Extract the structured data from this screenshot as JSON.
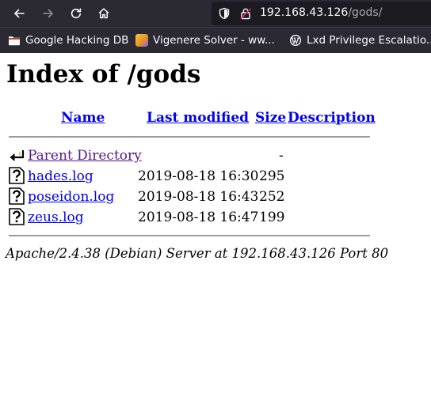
{
  "browser": {
    "url_host": "192.168.43.126",
    "url_path": "/gods/",
    "bookmarks": [
      {
        "label": "Google Hacking DB",
        "icon": "folder-icon"
      },
      {
        "label": "Vigenere Solver - ww...",
        "icon": "site-favicon"
      },
      {
        "label": "Lxd Privilege Escalatio...",
        "icon": "wordpress-icon"
      }
    ]
  },
  "page": {
    "title": "Index of /gods",
    "columns": {
      "name": "Name",
      "modified": "Last modified",
      "size": "Size",
      "description": "Description"
    },
    "parent": {
      "name": "Parent Directory",
      "size": "-"
    },
    "files": [
      {
        "name": "hades.log",
        "modified": "2019-08-18 16:30",
        "size": "295"
      },
      {
        "name": "poseidon.log",
        "modified": "2019-08-18 16:43",
        "size": "252"
      },
      {
        "name": "zeus.log",
        "modified": "2019-08-18 16:47",
        "size": "199"
      }
    ],
    "address": "Apache/2.4.38 (Debian) Server at 192.168.43.126 Port 80"
  }
}
